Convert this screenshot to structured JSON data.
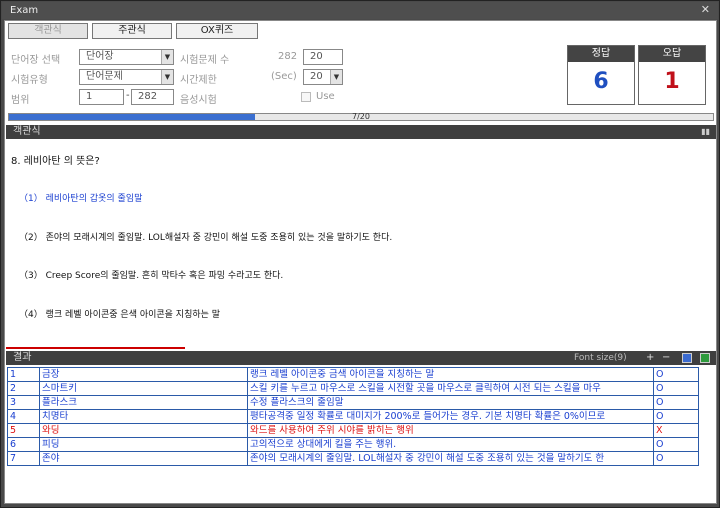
{
  "window": {
    "title": "Exam",
    "close_glyph": "✕"
  },
  "tabs": [
    {
      "label": "객관식"
    },
    {
      "label": "주관식"
    },
    {
      "label": "OX퀴즈"
    }
  ],
  "settings": {
    "vocab_label": "단어장 선택",
    "vocab_value": "단어장",
    "type_label": "시험유형",
    "type_value": "단어문제",
    "range_label": "범위",
    "range_from": "1",
    "range_dash": "-",
    "range_to": "282",
    "count_label": "시험문제 수",
    "count_max": "282",
    "count_value": "20",
    "time_label": "시간제한",
    "time_unit": "(Sec)",
    "time_value": "20",
    "voice_label": "음성시험",
    "use_label": "Use"
  },
  "score": {
    "correct_label": "정답",
    "correct_value": "6",
    "wrong_label": "오답",
    "wrong_value": "1",
    "correct_color": "#1f4fc0",
    "wrong_color": "#c0101a"
  },
  "progress": {
    "text": "7/20",
    "fraction": 0.35
  },
  "question_section": {
    "title": "객관식"
  },
  "question": {
    "text": "8. 레비아탄 의 뜻은?",
    "options": [
      "（1） 레비아탄의 갑옷의 줄임말",
      "（2） 존야의 모래시계의 줄임말. LOL해설자 중 강민이 해설 도중 조용히 있는 것을 말하기도 한다.",
      "（3） Creep Score의 줄임말. 흔히 막타수 혹은 파밍 수라고도 한다.",
      "（4） 랭크 레벨 아이콘중 은색 아이콘을 지칭하는 말"
    ]
  },
  "results": {
    "title": "결과",
    "font_size_label": "Font size(9)",
    "plus": "+",
    "minus": "−",
    "rows": [
      {
        "no": "1",
        "word": "금장",
        "meaning": "랭크 레벨 아이콘중 금색 아이콘을 지칭하는 말",
        "mark": "O",
        "wrong": false
      },
      {
        "no": "2",
        "word": "스마트키",
        "meaning": "스킬 키를 누르고 마우스로 스킬을 시전할 곳을 마우스로 클릭하여 시전 되는 스킬을 마우",
        "mark": "O",
        "wrong": false
      },
      {
        "no": "3",
        "word": "플라스크",
        "meaning": "수정 플라스크의 줄임말",
        "mark": "O",
        "wrong": false
      },
      {
        "no": "4",
        "word": "치명타",
        "meaning": "평타공격중 일정 확률로 대미지가 200%로 들어가는 경우. 기본 치명타 확률은 0%이므로",
        "mark": "O",
        "wrong": false
      },
      {
        "no": "5",
        "word": "와딩",
        "meaning": "와드를 사용하여 주위 시야를 밝히는 행위",
        "mark": "X",
        "wrong": true
      },
      {
        "no": "6",
        "word": "피딩",
        "meaning": "고의적으로 상대에게 킬을 주는 행위.",
        "mark": "O",
        "wrong": false
      },
      {
        "no": "7",
        "word": "존야",
        "meaning": "존야의 모래시계의 줄임말. LOL해설자 중 강민이 해설 도중 조용히 있는 것을 말하기도 한",
        "mark": "O",
        "wrong": false
      }
    ]
  }
}
